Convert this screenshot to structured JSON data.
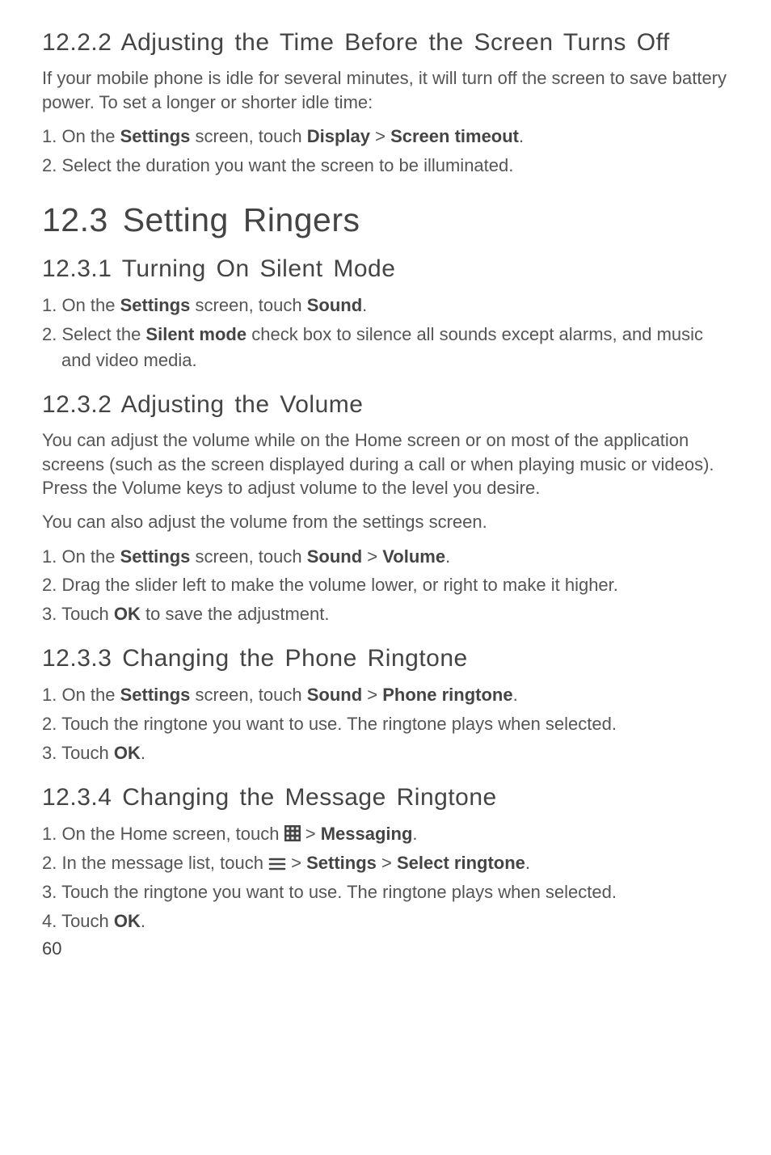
{
  "colors": {
    "heading": "#444444",
    "body": "#555555"
  },
  "sections": {
    "s1": {
      "heading": "12.2.2  Adjusting the Time Before the Screen Turns Off",
      "para": "If your mobile phone is idle for several minutes, it will turn off the screen to save battery power. To set a longer or shorter idle time:",
      "steps": {
        "one_a": "1. On the ",
        "one_b": "Settings",
        "one_c": " screen, touch ",
        "one_d": "Display",
        "one_e": " > ",
        "one_f": "Screen timeout",
        "one_g": ".",
        "two": "2. Select the duration you want the screen to be illuminated."
      }
    },
    "s_main": {
      "heading": "12.3  Setting Ringers"
    },
    "s2": {
      "heading": "12.3.1  Turning On Silent Mode",
      "steps": {
        "one_a": "1. On the ",
        "one_b": "Settings",
        "one_c": " screen, touch ",
        "one_d": "Sound",
        "one_e": ".",
        "two_a": "2. Select the ",
        "two_b": "Silent mode",
        "two_c": " check box to silence all sounds except alarms, and music and video media."
      }
    },
    "s3": {
      "heading": "12.3.2  Adjusting the Volume",
      "para1": "You can adjust the volume while on the Home screen or on most of the application screens (such as the screen displayed during a call or when playing music or videos). Press the Volume keys to adjust volume to the level you desire.",
      "para2": "You can also adjust the volume from the settings screen.",
      "steps": {
        "one_a": "1. On the ",
        "one_b": "Settings",
        "one_c": " screen, touch ",
        "one_d": "Sound",
        "one_e": " > ",
        "one_f": "Volume",
        "one_g": ".",
        "two": "2. Drag the slider left to make the volume lower, or right to make it higher.",
        "three_a": "3. Touch ",
        "three_b": "OK",
        "three_c": " to save the adjustment."
      }
    },
    "s4": {
      "heading": "12.3.3  Changing the Phone Ringtone",
      "steps": {
        "one_a": "1. On the ",
        "one_b": "Settings",
        "one_c": " screen, touch ",
        "one_d": "Sound",
        "one_e": " > ",
        "one_f": "Phone ringtone",
        "one_g": ".",
        "two": "2. Touch the ringtone you want to use. The ringtone plays when selected.",
        "three_a": "3. Touch ",
        "three_b": "OK",
        "three_c": "."
      }
    },
    "s5": {
      "heading": "12.3.4  Changing the Message Ringtone",
      "steps": {
        "one_a": "1. On the Home screen, touch ",
        "one_b": " > ",
        "one_c": "Messaging",
        "one_d": ".",
        "two_a": "2. In the message list, touch ",
        "two_b": " > ",
        "two_c": "Settings",
        "two_d": " > ",
        "two_e": "Select ringtone",
        "two_f": ".",
        "three": "3. Touch the ringtone you want to use. The ringtone plays when selected.",
        "four_a": "4. Touch ",
        "four_b": "OK",
        "four_c": "."
      }
    }
  },
  "page_number": "60",
  "icons": {
    "grid": "apps-grid-icon",
    "menu": "menu-icon"
  }
}
